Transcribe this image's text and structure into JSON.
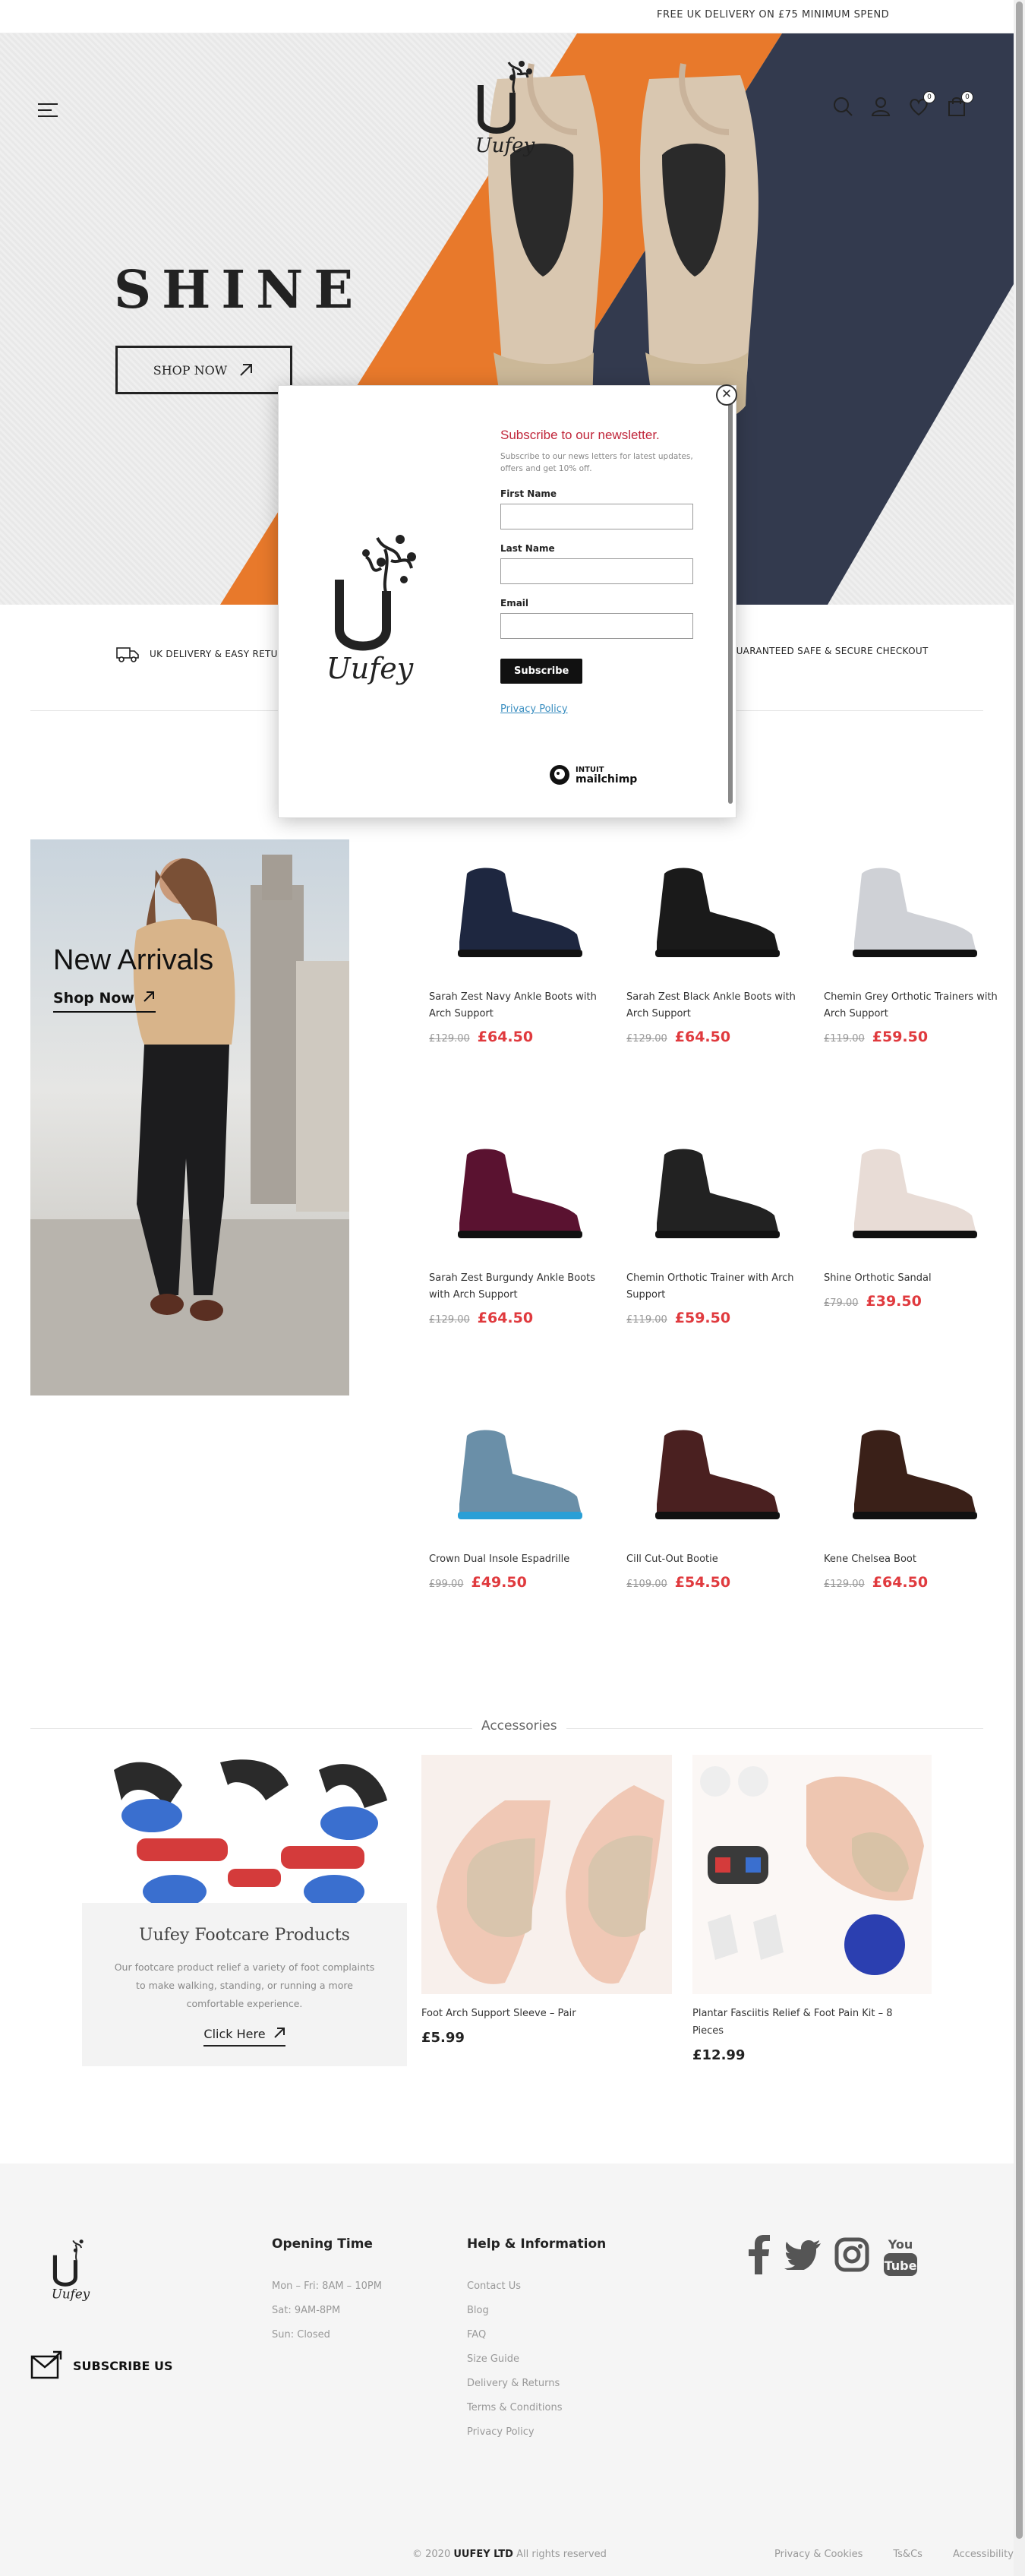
{
  "topbar": {
    "text": "FREE UK DELIVERY ON £75 MINIMUM SPEND"
  },
  "brand": {
    "name": "Uufey"
  },
  "hero": {
    "headline": "SHINE",
    "cta": "SHOP NOW"
  },
  "header": {
    "wishlist_count": "0",
    "cart_count": "0"
  },
  "features": [
    {
      "icon": "truck-icon",
      "label": "UK DELIVERY & EASY RETURNS"
    },
    {
      "icon": "lock-icon",
      "label": "GUARANTEED SAFE & SECURE CHECKOUT"
    }
  ],
  "new_arrivals": {
    "title": "New Arrivals",
    "link": "Shop Now"
  },
  "products": [
    {
      "name": "Sarah Zest Navy Ankle Boots with Arch Support",
      "old": "£129.00",
      "price": "£64.50"
    },
    {
      "name": "Sarah Zest Black Ankle Boots with Arch Support",
      "old": "£129.00",
      "price": "£64.50"
    },
    {
      "name": "Chemin Grey Orthotic Trainers with Arch Support",
      "old": "£119.00",
      "price": "£59.50"
    },
    {
      "name": "Sarah Zest Burgundy Ankle Boots with Arch Support",
      "old": "£129.00",
      "price": "£64.50"
    },
    {
      "name": "Chemin Orthotic Trainer with Arch Support",
      "old": "£119.00",
      "price": "£59.50"
    },
    {
      "name": "Shine Orthotic Sandal",
      "old": "£79.00",
      "price": "£39.50"
    },
    {
      "name": "Crown Dual Insole Espadrille",
      "old": "£99.00",
      "price": "£49.50"
    },
    {
      "name": "Cill Cut-Out Bootie",
      "old": "£109.00",
      "price": "£54.50"
    },
    {
      "name": "Kene Chelsea Boot",
      "old": "£129.00",
      "price": "£64.50"
    }
  ],
  "accessories": {
    "title": "Accessories",
    "card_title": "Uufey Footcare Products",
    "card_text": "Our footcare product relief a variety of foot complaints to make walking, standing, or running a more comfortable experience.",
    "card_link": "Click Here",
    "items": [
      {
        "name": "Foot Arch Support Sleeve – Pair",
        "price": "£5.99"
      },
      {
        "name": "Plantar Fasciitis Relief & Foot Pain Kit – 8 Pieces",
        "price": "£12.99"
      }
    ]
  },
  "footer": {
    "subscribe": "SUBSCRIBE US",
    "opening_title": "Opening Time",
    "opening": [
      "Mon – Fri: 8AM – 10PM",
      "Sat: 9AM-8PM",
      "Sun: Closed"
    ],
    "help_title": "Help & Information",
    "help": [
      "Contact Us",
      "Blog",
      "FAQ",
      "Size Guide",
      "Delivery & Returns",
      "Terms & Conditions",
      "Privacy Policy"
    ],
    "copy_prefix": "© 2020",
    "copy_brand": "UUFEY LTD",
    "copy_suffix": "All rights reserved",
    "links": [
      "Privacy & Cookies",
      "Ts&Cs",
      "Accessibility"
    ]
  },
  "popup": {
    "title": "Subscribe to our newsletter.",
    "subtitle": "Subscribe to our news letters for latest updates, offers and get 10% off.",
    "first_name": "First Name",
    "last_name": "Last Name",
    "email": "Email",
    "button": "Subscribe",
    "privacy": "Privacy Policy",
    "mailchimp_top": "INTUIT",
    "mailchimp_bottom": "mailchimp"
  },
  "colors": {
    "sale": "#e03a3e",
    "orange": "#e8792b",
    "navy": "#333a4e",
    "popup_title": "#c0263a"
  }
}
